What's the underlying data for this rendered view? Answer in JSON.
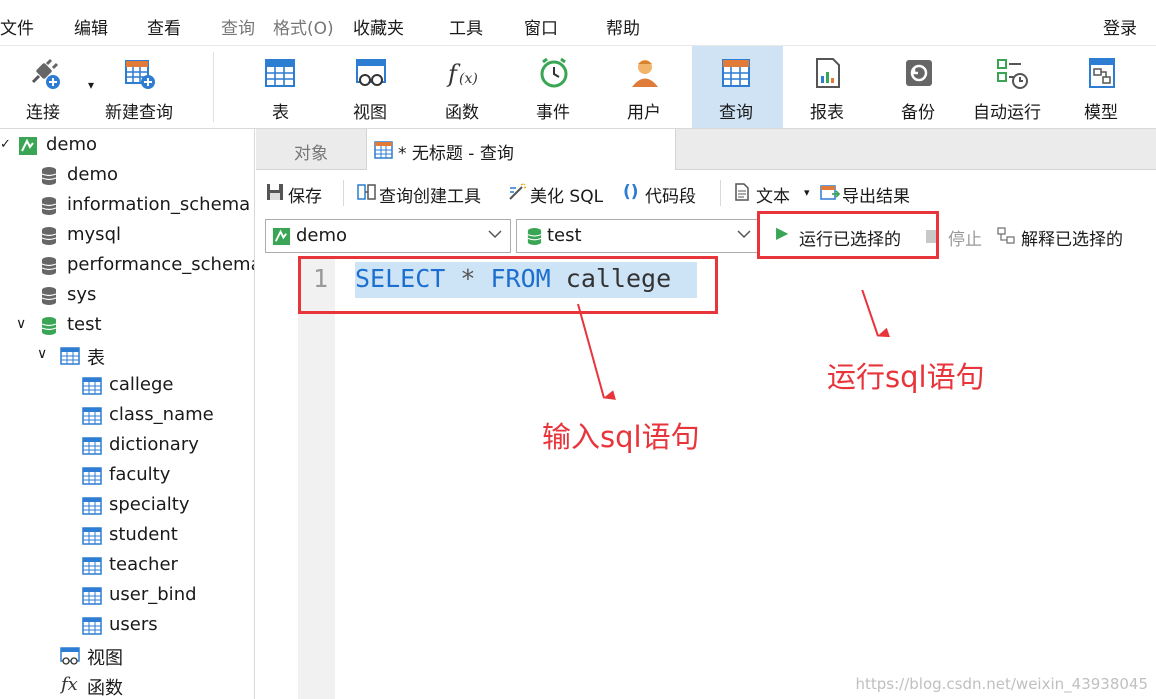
{
  "menubar": {
    "items": [
      "文件",
      "编辑",
      "查看",
      "查询",
      "格式(O)",
      "收藏夹",
      "工具",
      "窗口",
      "帮助"
    ],
    "login": "登录"
  },
  "toolbar": {
    "connect": "连接",
    "new_query": "新建查询",
    "table": "表",
    "view": "视图",
    "function": "函数",
    "event": "事件",
    "user": "用户",
    "query": "查询",
    "report": "报表",
    "backup": "备份",
    "autorun": "自动运行",
    "model": "模型"
  },
  "sidebar": {
    "root": "demo",
    "databases": [
      "demo",
      "information_schema",
      "mysql",
      "performance_schema",
      "sys",
      "test"
    ],
    "tables_folder": "表",
    "tables": [
      "callege",
      "class_name",
      "dictionary",
      "faculty",
      "specialty",
      "student",
      "teacher",
      "user_bind",
      "users"
    ],
    "views_folder": "视图",
    "functions_folder": "函数"
  },
  "tabs": {
    "objects": "对象",
    "query_tab": "* 无标题 - 查询"
  },
  "query_toolbar": {
    "save": "保存",
    "builder": "查询创建工具",
    "beautify": "美化 SQL",
    "snippet": "代码段",
    "text": "文本",
    "export": "导出结果"
  },
  "selectors": {
    "connection": "demo",
    "database": "test"
  },
  "run_bar": {
    "run_selected": "运行已选择的",
    "stop": "停止",
    "explain": "解释已选择的"
  },
  "editor": {
    "line_number": "1",
    "sql_select": "SELECT",
    "sql_star": "*",
    "sql_from": "FROM",
    "sql_table": "callege"
  },
  "annotations": {
    "run_label": "运行sql语句",
    "input_label": "输入sql语句",
    "color": "#e8343b"
  },
  "watermark": "https://blog.csdn.net/weixin_43938045"
}
